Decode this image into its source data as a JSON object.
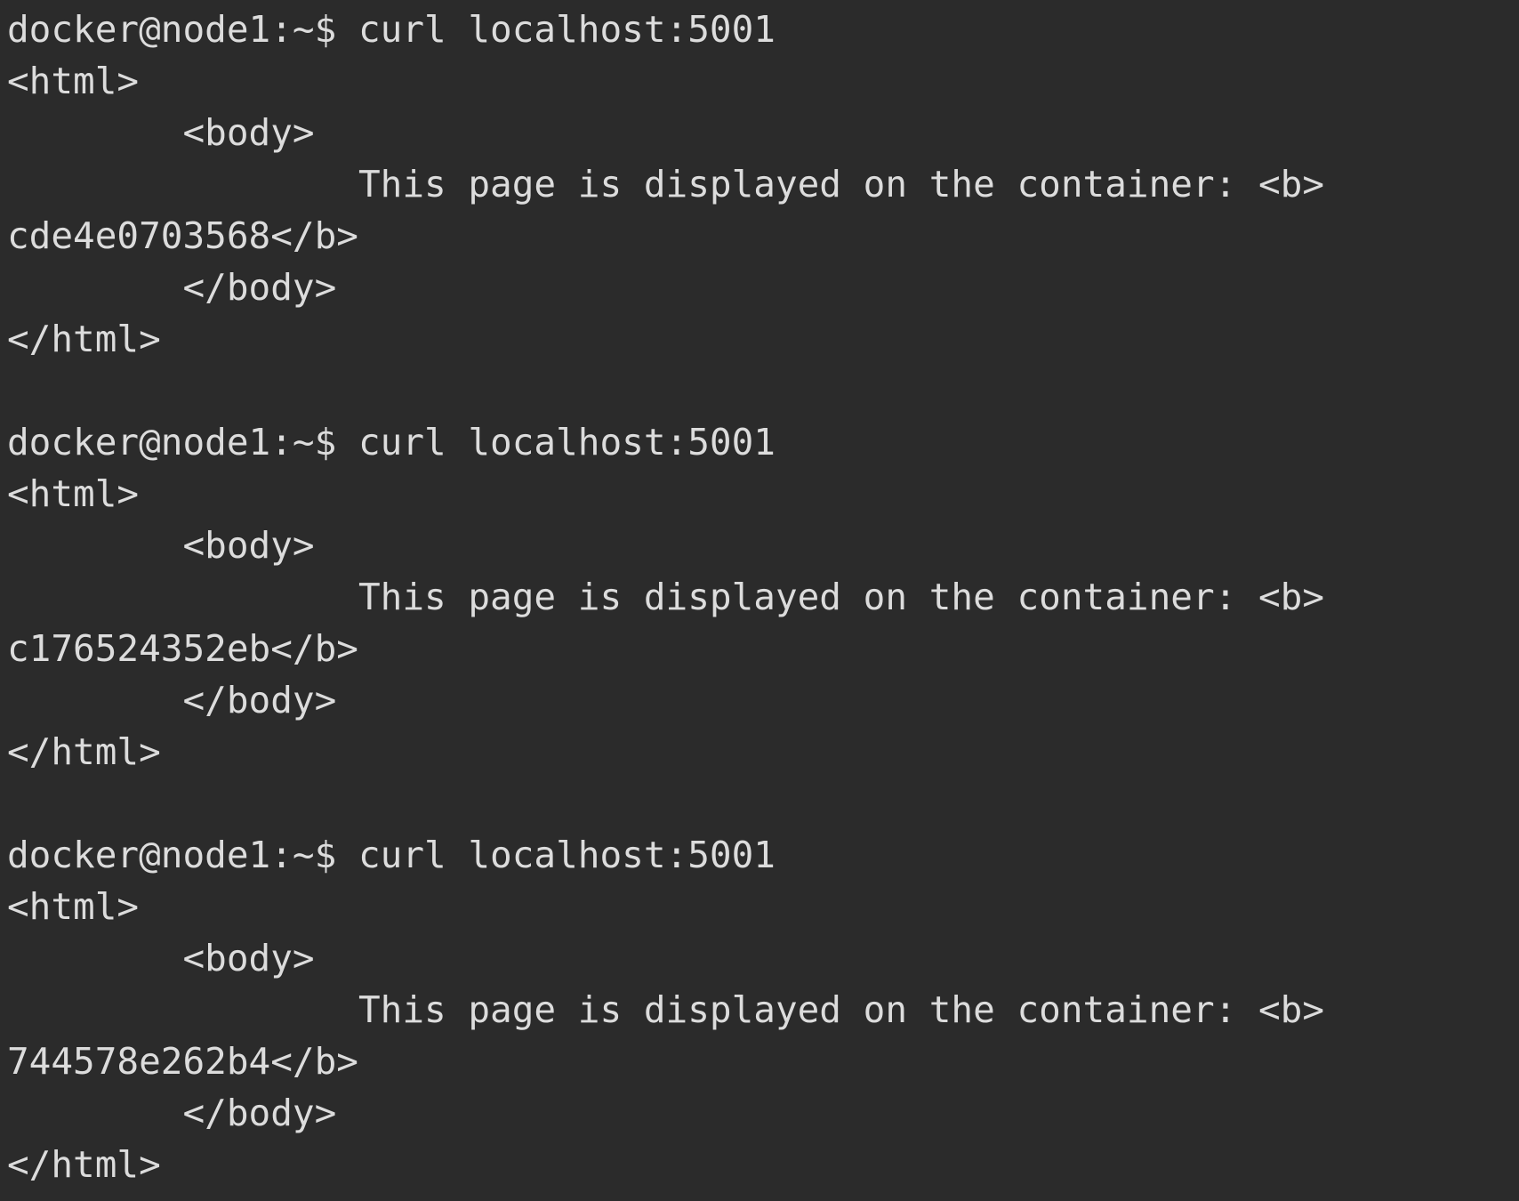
{
  "theme": {
    "background": "#2b2b2b",
    "foreground": "#dcdcdc"
  },
  "terminal": {
    "lines": [
      "docker@node1:~$ curl localhost:5001",
      "<html>",
      "        <body>",
      "                This page is displayed on the container: <b>",
      "cde4e0703568</b>",
      "        </body>",
      "</html>",
      "",
      "docker@node1:~$ curl localhost:5001",
      "<html>",
      "        <body>",
      "                This page is displayed on the container: <b>",
      "c176524352eb</b>",
      "        </body>",
      "</html>",
      "",
      "docker@node1:~$ curl localhost:5001",
      "<html>",
      "        <body>",
      "                This page is displayed on the container: <b>",
      "744578e262b4</b>",
      "        </body>",
      "</html>"
    ]
  }
}
